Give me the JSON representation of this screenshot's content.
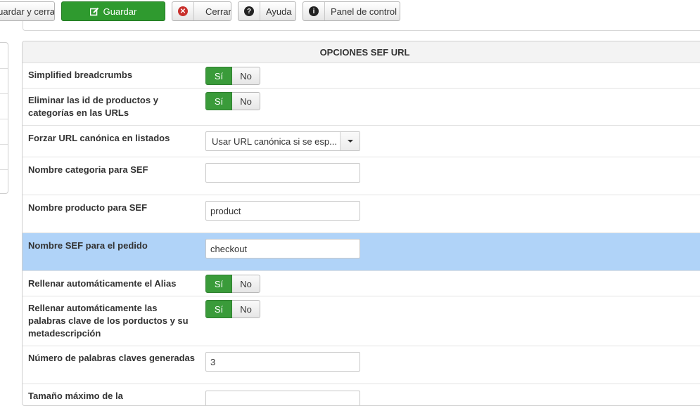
{
  "toolbar": {
    "save_close_label": "Guardar y cerrar",
    "save_label": "Guardar",
    "close_label": "Cerrar",
    "help_label": "Ayuda",
    "panel_label": "Panel de control",
    "save_color": "#2f9a2f"
  },
  "panel": {
    "title": "OPCIONES SEF URL",
    "highlight_color": "#b0d3f8"
  },
  "rows": [
    {
      "label": "Simplified breadcrumbs",
      "yes": "Sí",
      "no": "No",
      "selected": "Sí"
    },
    {
      "label": "Eliminar las id de productos y categorías en las URLs",
      "yes": "Sí",
      "no": "No",
      "selected": "Sí"
    },
    {
      "label": "Forzar URL canónica en listados",
      "value": "Usar URL canónica si se esp..."
    },
    {
      "label": "Nombre categoria para SEF",
      "value": ""
    },
    {
      "label": "Nombre producto para SEF",
      "value": "product"
    },
    {
      "label": "Nombre SEF para el pedido",
      "value": "checkout"
    },
    {
      "label": "Rellenar automáticamente el Alias",
      "yes": "Sí",
      "no": "No",
      "selected": "Sí"
    },
    {
      "label": "Rellenar automáticamente las palabras clave de los porductos y su metadescripción",
      "yes": "Sí",
      "no": "No",
      "selected": "Sí"
    },
    {
      "label": "Número de palabras claves generadas",
      "value": "3"
    },
    {
      "label": "Tamaño máximo de la",
      "value": ""
    }
  ]
}
